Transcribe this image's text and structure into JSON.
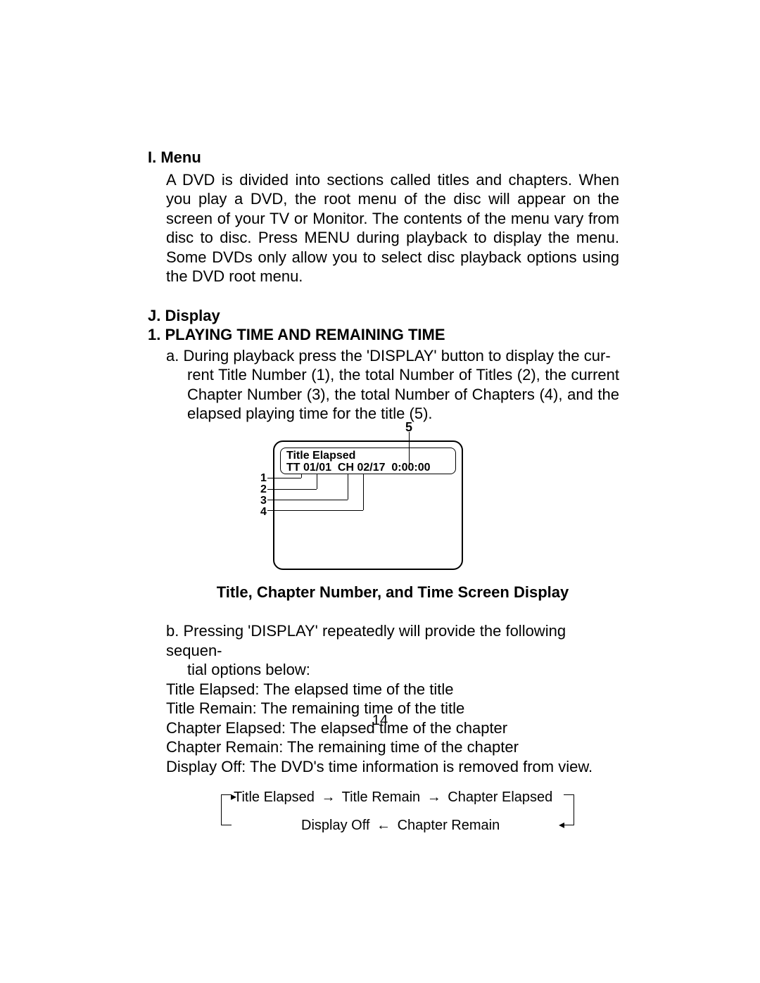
{
  "section_I": {
    "heading": "I. Menu",
    "body": "A DVD is divided into sections called titles and chapters. When you play a DVD, the root menu of the disc will appear on the screen of your TV or Monitor. The contents of the menu  vary from disc to disc. Press MENU during playback to display the menu. Some DVDs only allow you to select disc playback options using the DVD root menu."
  },
  "section_J": {
    "heading": "J. Display",
    "sub1_heading": "1. PLAYING TIME AND REMAINING TIME",
    "item_a_first": "a. During playback press the 'DISPLAY' button to display the cur-",
    "item_a_rest": "rent  Title Number (1), the total Number of Titles (2), the current Chapter Number (3), the total Number of Chapters (4), and the elapsed  playing  time for the title (5).",
    "osd": {
      "line1": "Title Elapsed",
      "line2": "TT 01/01  CH 02/17  0:00:00",
      "callouts": {
        "c1": "1",
        "c2": "2",
        "c3": "3",
        "c4": "4",
        "c5": "5"
      }
    },
    "fig_caption": "Title, Chapter Number, and Time Screen Display",
    "item_b_first": "b. Pressing  'DISPLAY' repeatedly will provide the following sequen-",
    "item_b_rest": "tial options below:",
    "options": [
      "Title Elapsed: The elapsed time of the title",
      "Title Remain: The remaining time of  the title",
      "Chapter Elapsed: The elapsed time of the chapter",
      "Chapter Remain: The remaining time of the chapter",
      "Display Off: The DVD's time information is removed from view."
    ],
    "cycle": {
      "a": "Title Elapsed",
      "b": "Title Remain",
      "c": "Chapter Elapsed",
      "d": "Chapter Remain",
      "e": "Display Off"
    }
  },
  "page_number": "14"
}
